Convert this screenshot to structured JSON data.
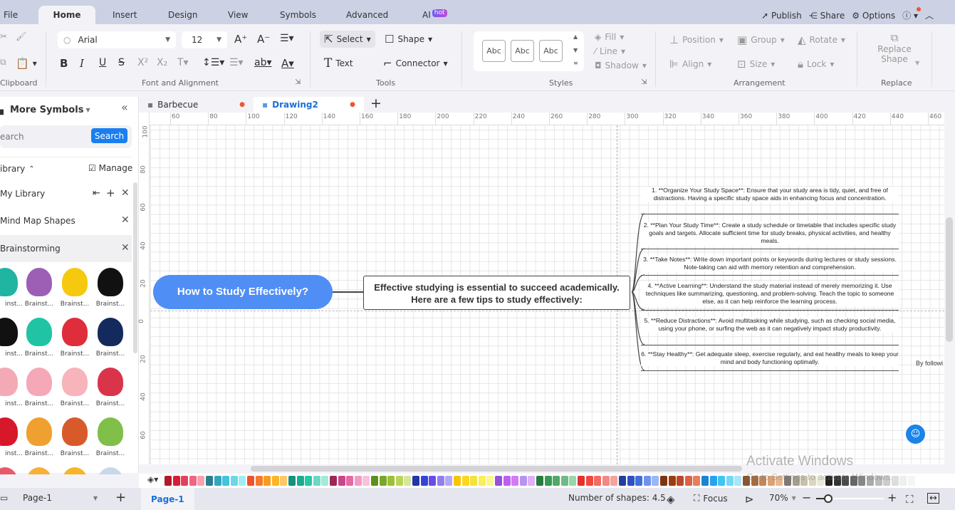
{
  "menu": {
    "tabs": [
      "File",
      "Home",
      "Insert",
      "Design",
      "View",
      "Symbols",
      "Advanced",
      "AI"
    ],
    "ai_badge": "hot",
    "right": {
      "publish": "Publish",
      "share": "Share",
      "options": "Options"
    }
  },
  "ribbon": {
    "font_name": "Arial",
    "font_size": "12",
    "groups": {
      "clipboard": "Clipboard",
      "font": "Font and Alignment",
      "tools": "Tools",
      "styles": "Styles",
      "arrangement": "Arrangement",
      "replace": "Replace"
    },
    "tools": {
      "select": "Select",
      "shape": "Shape",
      "text": "Text",
      "connector": "Connector"
    },
    "styles": {
      "abc": "Abc",
      "fill": "Fill",
      "line": "Line",
      "shadow": "Shadow"
    },
    "arrangement": {
      "position": "Position",
      "group": "Group",
      "rotate": "Rotate",
      "align": "Align",
      "size": "Size",
      "lock": "Lock"
    },
    "replace": {
      "line1": "Replace",
      "line2": "Shape"
    }
  },
  "left_panel": {
    "title": "More Symbols",
    "search_placeholder": "earch",
    "search_button": "Search",
    "library_label": "ibrary",
    "manage": "Manage",
    "libraries": [
      "My Library",
      "Mind Map Shapes",
      "Brainstorming"
    ],
    "symbol_label": "Brainst...",
    "symbol_label_cut": "inst..."
  },
  "doc_tabs": [
    {
      "name": "Barbecue",
      "active": false
    },
    {
      "name": "Drawing2",
      "active": true
    }
  ],
  "ruler": {
    "h": [
      "60",
      "80",
      "100",
      "120",
      "140",
      "160",
      "180",
      "200",
      "220",
      "240",
      "260",
      "280",
      "300",
      "320",
      "340",
      "360",
      "380",
      "400",
      "420",
      "440",
      "460"
    ],
    "v": [
      "100",
      "80",
      "60",
      "40",
      "20",
      "0",
      "20",
      "40",
      "60"
    ]
  },
  "diagram": {
    "root": "How to Study Effectively?",
    "main": "Effective studying is essential to succeed academically. Here are a few tips to study effectively:",
    "tips": [
      "1. **Organize Your Study Space**: Ensure that your study area is tidy, quiet, and free of distractions. Having a specific study space aids in enhancing focus and concentration.",
      "2. **Plan Your Study Time**: Create a study schedule or timetable that includes specific study goals and targets. Allocate sufficient time for study breaks, physical activities, and healthy meals.",
      "3. **Take Notes**: Write down important points or keywords during lectures or study sessions. Note-taking can aid with memory retention and comprehension.",
      "4. **Active Learning**: Understand the study material instead of merely memorizing it. Use techniques like summarizing, questioning, and problem-solving. Teach the topic to someone else, as it can help reinforce the learning process.",
      "5. **Reduce Distractions**: Avoid multitasking while studying, such as checking social media, using your phone, or surfing the web as it can negatively impact study productivity.",
      "6. **Stay Healthy**: Get adequate sleep, exercise regularly, and eat healthy meals to keep your mind and body functioning optimally."
    ],
    "trailing": "By followi"
  },
  "palette": [
    "#b5172a",
    "#d41e35",
    "#e5405b",
    "#f06585",
    "#f7a1b1",
    "#2a7f8f",
    "#35a5bd",
    "#45c3dc",
    "#6cd8e6",
    "#a4ecf3",
    "#f0522a",
    "#f7792e",
    "#f99c1d",
    "#fbb626",
    "#fdc765",
    "#16917a",
    "#1aac8e",
    "#25c8a9",
    "#6fd8c3",
    "#a3ead9",
    "#9c2757",
    "#c9468a",
    "#e46aa6",
    "#f39ac5",
    "#f6c3d9",
    "#5e8f1b",
    "#79a826",
    "#9dc035",
    "#b9d459",
    "#d7e69a",
    "#2237a8",
    "#3544d6",
    "#6a4be8",
    "#957df0",
    "#b3a8f2",
    "#f9c500",
    "#fcd622",
    "#f5e23a",
    "#f9ee5e",
    "#fbf68e",
    "#9a4fd8",
    "#be5ff0",
    "#d37bf4",
    "#b894f0",
    "#dcb2f4",
    "#2a7a41",
    "#379a55",
    "#52a76b",
    "#6dbc84",
    "#96d8a8",
    "#e0332b",
    "#f2473e",
    "#f66a62",
    "#f68882",
    "#f4a49e",
    "#233f9e",
    "#2d51c2",
    "#3f6fe0",
    "#6c94ee",
    "#9bb8f4",
    "#7c3512",
    "#9a3d10",
    "#b9482c",
    "#d86449",
    "#e77e5d",
    "#1a84d4",
    "#2aa2ec",
    "#40c4f2",
    "#74d8f4",
    "#a7e6f6",
    "#8a5532",
    "#a66b40",
    "#c38656",
    "#daa176",
    "#e8b88e",
    "#7d7a72",
    "#a6a08e",
    "#c7c1ab",
    "#ddd6be",
    "#eee9d5",
    "#222222",
    "#333333",
    "#4a4a4a",
    "#666666",
    "#888888",
    "#aaaaaa",
    "#bbbbbb",
    "#cccccc",
    "#dddddd",
    "#eeeeee",
    "#f5f5f5"
  ],
  "status": {
    "page_select": "Page-1",
    "page_tab": "Page-1",
    "shapes": "Number of shapes: 4.5",
    "focus": "Focus",
    "zoom": "70%",
    "zoom_fraction": 0.18
  },
  "watermark": {
    "line1": "Activate Windows",
    "line2": "Go to Settings to activate Windows."
  }
}
